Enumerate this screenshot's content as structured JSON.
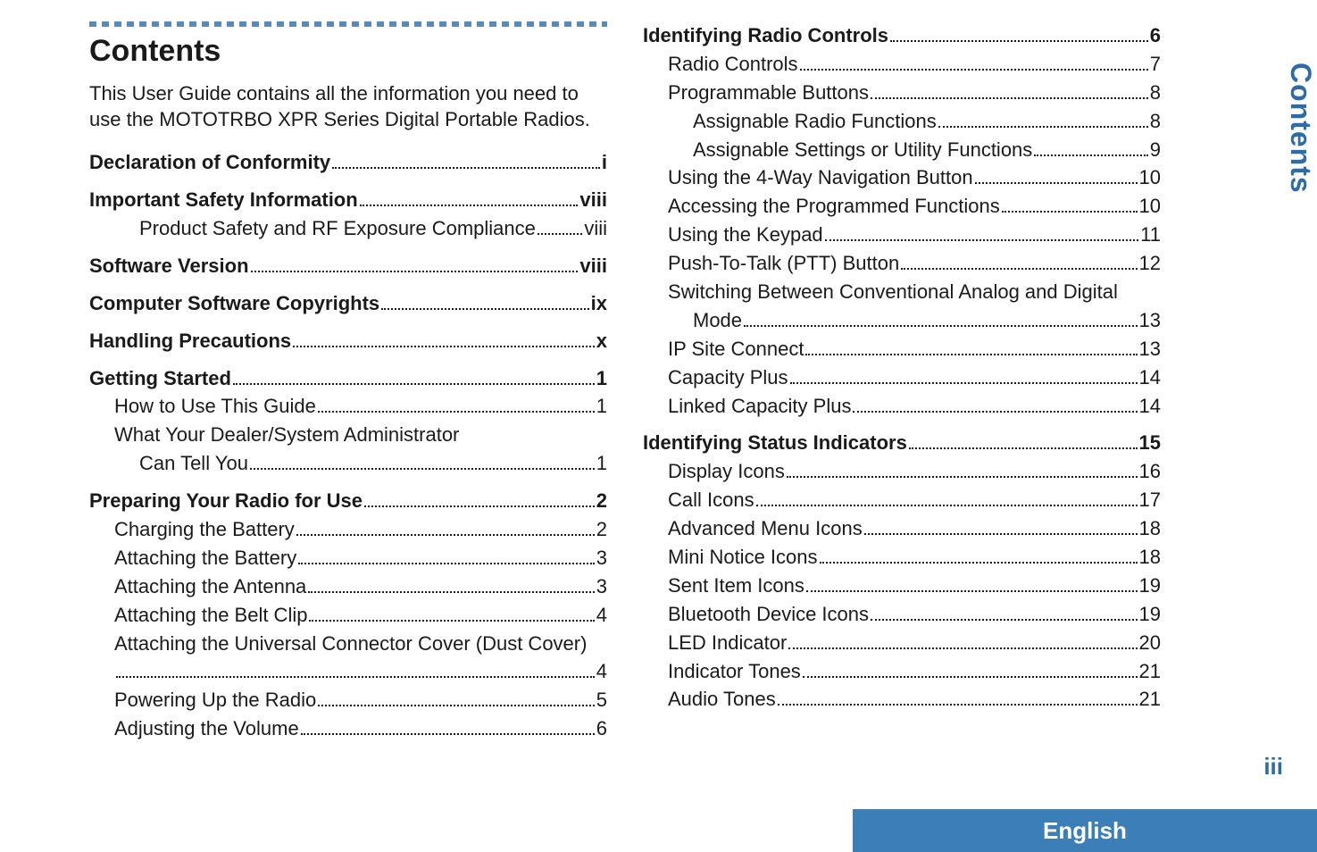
{
  "side_tab": "Contents",
  "page_number": "iii",
  "language_bar": "English",
  "left_column": {
    "title": "Contents",
    "intro": "This User Guide contains all the information you need to use the MOTOTRBO XPR Series Digital Portable Radios.",
    "entries": [
      {
        "label": "Declaration of Conformity",
        "page": "i",
        "bold": true,
        "indent": 0
      },
      {
        "label": "Important Safety Information",
        "page": "viii",
        "bold": true,
        "indent": 0,
        "gap": true
      },
      {
        "label": "Product Safety and RF Exposure Compliance",
        "page": "viii",
        "bold": false,
        "indent": 2
      },
      {
        "label": "Software Version",
        "page": "viii",
        "bold": true,
        "indent": 0,
        "gap": true
      },
      {
        "label": "Computer Software Copyrights",
        "page": "ix",
        "bold": true,
        "indent": 0,
        "gap": true
      },
      {
        "label": "Handling Precautions",
        "page": "x",
        "bold": true,
        "indent": 0,
        "gap": true
      },
      {
        "label": "Getting Started",
        "page": "1",
        "bold": true,
        "indent": 0,
        "gap": true
      },
      {
        "label": "How to Use This Guide",
        "page": "1",
        "bold": false,
        "indent": 1
      },
      {
        "label": "What Your Dealer/System Administrator",
        "page": "",
        "bold": false,
        "indent": 1,
        "nodots": true
      },
      {
        "label": "Can Tell You",
        "page": "1",
        "bold": false,
        "indent": 2
      },
      {
        "label": "Preparing Your Radio for Use",
        "page": "2",
        "bold": true,
        "indent": 0,
        "gap": true
      },
      {
        "label": "Charging the Battery",
        "page": "2",
        "bold": false,
        "indent": 1
      },
      {
        "label": "Attaching the Battery",
        "page": "3",
        "bold": false,
        "indent": 1
      },
      {
        "label": "Attaching the Antenna",
        "page": "3",
        "bold": false,
        "indent": 1
      },
      {
        "label": "Attaching the Belt Clip",
        "page": "4",
        "bold": false,
        "indent": 1
      },
      {
        "label": "Attaching the Universal Connector Cover (Dust Cover)",
        "page": "",
        "bold": false,
        "indent": 1,
        "nodots": true
      },
      {
        "label": "",
        "page": "4",
        "bold": false,
        "indent": 1,
        "filler": true
      },
      {
        "label": "Powering Up the Radio",
        "page": "5",
        "bold": false,
        "indent": 1
      },
      {
        "label": "Adjusting the Volume",
        "page": "6",
        "bold": false,
        "indent": 1
      }
    ]
  },
  "right_column": {
    "entries": [
      {
        "label": "Identifying Radio Controls",
        "page": "6",
        "bold": true,
        "indent": 0
      },
      {
        "label": "Radio Controls",
        "page": "7",
        "bold": false,
        "indent": 1
      },
      {
        "label": "Programmable Buttons",
        "page": "8",
        "bold": false,
        "indent": 1
      },
      {
        "label": "Assignable Radio Functions",
        "page": "8",
        "bold": false,
        "indent": 2
      },
      {
        "label": "Assignable Settings or Utility Functions",
        "page": "9",
        "bold": false,
        "indent": 2
      },
      {
        "label": "Using the 4-Way Navigation Button",
        "page": "10",
        "bold": false,
        "indent": 1
      },
      {
        "label": "Accessing the Programmed Functions",
        "page": "10",
        "bold": false,
        "indent": 1
      },
      {
        "label": "Using the Keypad",
        "page": "11",
        "bold": false,
        "indent": 1
      },
      {
        "label": "Push-To-Talk (PTT) Button",
        "page": "12",
        "bold": false,
        "indent": 1
      },
      {
        "label": "Switching Between Conventional Analog and Digital",
        "page": "",
        "bold": false,
        "indent": 1,
        "nodots": true
      },
      {
        "label": "Mode",
        "page": "13",
        "bold": false,
        "indent": 2
      },
      {
        "label": "IP Site Connect",
        "page": "13",
        "bold": false,
        "indent": 1
      },
      {
        "label": "Capacity Plus",
        "page": "14",
        "bold": false,
        "indent": 1
      },
      {
        "label": "Linked Capacity Plus",
        "page": "14",
        "bold": false,
        "indent": 1
      },
      {
        "label": "Identifying Status Indicators",
        "page": "15",
        "bold": true,
        "indent": 0,
        "gap": true
      },
      {
        "label": "Display Icons",
        "page": "16",
        "bold": false,
        "indent": 1
      },
      {
        "label": "Call Icons",
        "page": "17",
        "bold": false,
        "indent": 1
      },
      {
        "label": "Advanced Menu Icons",
        "page": "18",
        "bold": false,
        "indent": 1
      },
      {
        "label": "Mini Notice Icons",
        "page": "18",
        "bold": false,
        "indent": 1
      },
      {
        "label": "Sent Item Icons",
        "page": "19",
        "bold": false,
        "indent": 1
      },
      {
        "label": "Bluetooth Device Icons",
        "page": "19",
        "bold": false,
        "indent": 1
      },
      {
        "label": "LED Indicator",
        "page": "20",
        "bold": false,
        "indent": 1
      },
      {
        "label": "Indicator Tones",
        "page": "21",
        "bold": false,
        "indent": 1
      },
      {
        "label": "Audio Tones",
        "page": "21",
        "bold": false,
        "indent": 1
      }
    ]
  }
}
